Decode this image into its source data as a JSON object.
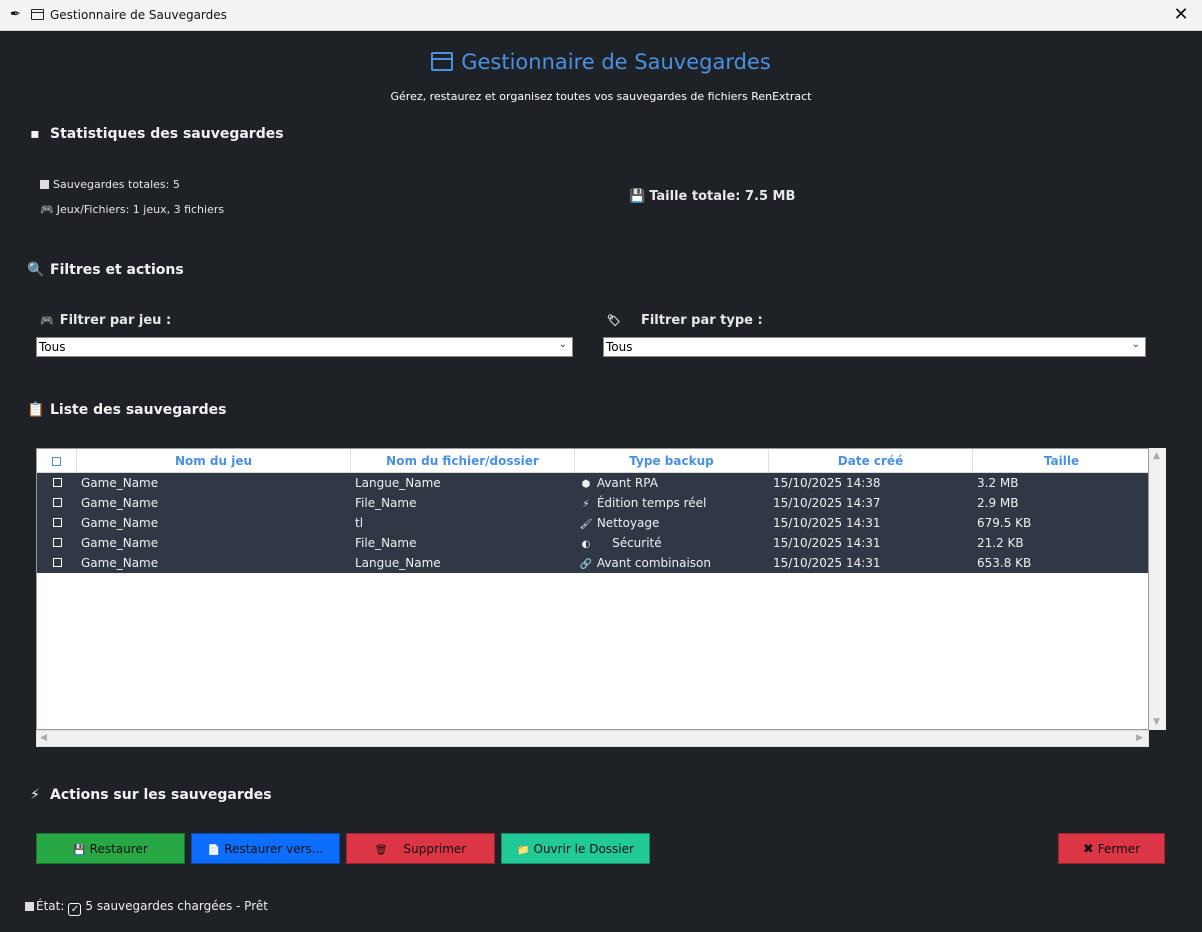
{
  "window": {
    "title": "Gestionnaire de Sauvegardes",
    "close_glyph": "✕"
  },
  "header": {
    "title": "Gestionnaire de Sauvegardes",
    "subtitle": "Gérez, restaurez et organisez toutes vos sauvegardes de fichiers RenExtract"
  },
  "stats": {
    "section_title": "Statistiques des sauvegardes",
    "total_backups": "Sauvegardes totales: 5",
    "games_files": "Jeux/Fichiers: 1 jeux, 3 fichiers",
    "total_size": "Taille totale: 7.5 MB"
  },
  "filters": {
    "section_title": "Filtres et actions",
    "game_label": "Filtrer par jeu :",
    "game_value": "Tous",
    "type_label": "Filtrer par type :",
    "type_value": "Tous"
  },
  "list": {
    "section_title": "Liste des sauvegardes",
    "columns": [
      "Nom du jeu",
      "Nom du fichier/dossier",
      "Type backup",
      "Date créé",
      "Taille"
    ],
    "rows": [
      {
        "game": "Game_Name",
        "file": "Langue_Name",
        "type_icon": "⬢",
        "type": "Avant RPA",
        "date": "15/10/2025 14:38",
        "size": "3.2 MB"
      },
      {
        "game": "Game_Name",
        "file": "File_Name",
        "type_icon": "⚡",
        "type": "Édition temps réel",
        "date": "15/10/2025 14:37",
        "size": "2.9 MB"
      },
      {
        "game": "Game_Name",
        "file": "tl",
        "type_icon": "🖌",
        "type": "Nettoyage",
        "date": "15/10/2025 14:31",
        "size": "679.5 KB"
      },
      {
        "game": "Game_Name",
        "file": "File_Name",
        "type_icon": "◐",
        "type": "    Sécurité",
        "date": "15/10/2025 14:31",
        "size": "21.2 KB"
      },
      {
        "game": "Game_Name",
        "file": "Langue_Name",
        "type_icon": "🔗",
        "type": "Avant combinaison",
        "date": "15/10/2025 14:31",
        "size": "653.8 KB"
      }
    ]
  },
  "actions": {
    "section_title": "Actions sur les sauvegardes",
    "restore": "Restaurer",
    "restore_to": "Restaurer vers...",
    "delete": "Supprimer",
    "open_folder": "Ouvrir le Dossier",
    "close": "Fermer"
  },
  "status": {
    "label": "État:",
    "text": "5 sauvegardes chargées - Prêt"
  },
  "colors": {
    "background": "#1e2227",
    "accent": "#4a90e2",
    "row_bg": "#303846",
    "restore": "#28a745",
    "restore_to": "#0d6efd",
    "delete": "#dc3545",
    "open_folder": "#20c997",
    "close": "#dc3545"
  }
}
